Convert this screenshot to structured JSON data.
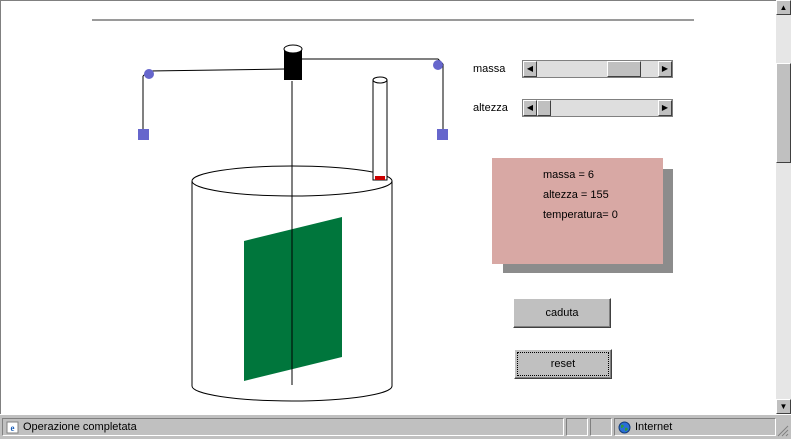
{
  "controls": {
    "massa_label": "massa",
    "altezza_label": "altezza",
    "massa_fraction": 0.8,
    "altezza_fraction": 0.0
  },
  "readout": {
    "massa": "massa = 6",
    "altezza": "altezza = 155",
    "temperatura": "temperatura= 0"
  },
  "buttons": {
    "caduta": "caduta",
    "reset": "reset"
  },
  "statusbar": {
    "message": "Operazione completata",
    "zone": "Internet"
  },
  "colors": {
    "paddle": "#00763c",
    "pulley": "#6666cc",
    "panel": "#d8a8a4",
    "thermometer_bulb": "#cc0000"
  }
}
